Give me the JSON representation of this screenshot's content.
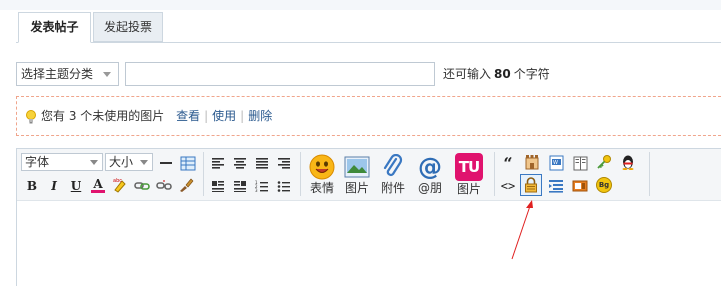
{
  "tabs": [
    {
      "label": "发表帖子",
      "active": true
    },
    {
      "label": "发起投票",
      "active": false
    }
  ],
  "subject": {
    "category_label": "选择主题分类",
    "title_value": "",
    "hint_prefix": "还可输入",
    "hint_count": "80",
    "hint_suffix": "个字符"
  },
  "notice": {
    "text": "您有 3 个未使用的图片",
    "view_link": "查看",
    "use_link": "使用",
    "delete_link": "删除",
    "separator": "|"
  },
  "editor": {
    "font_label": "字体",
    "size_label": "大小",
    "bold_glyph": "B",
    "italic_glyph": "I",
    "underline_glyph": "U",
    "fontcolor_glyph": "A",
    "quote_glyph": "“",
    "code_glyph": "<>",
    "big_buttons": [
      {
        "label": "表情",
        "icon": "smiley-icon"
      },
      {
        "label": "图片",
        "icon": "image-icon"
      },
      {
        "label": "附件",
        "icon": "paperclip-icon"
      },
      {
        "label": "@朋",
        "icon": "at-icon"
      },
      {
        "label": "图片",
        "icon": "tu-icon"
      }
    ],
    "tu_glyph": "TU",
    "at_glyph": "@",
    "bg_glyph": "Bg",
    "content": ""
  },
  "colors": {
    "accent_link": "#2b5a8f",
    "notice_border": "#f0a58c",
    "arrow": "#e02020",
    "tu_brand": "#e0136e"
  }
}
